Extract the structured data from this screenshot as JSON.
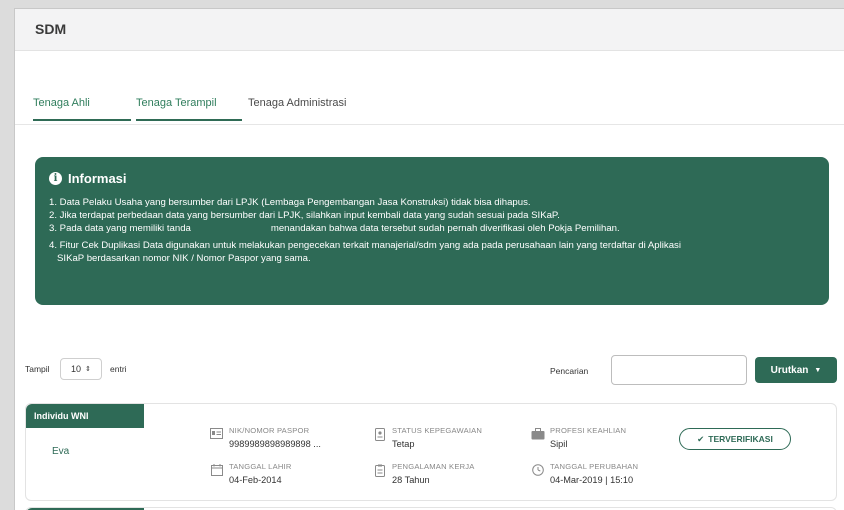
{
  "header": {
    "title": "SDM"
  },
  "tabs": [
    {
      "label": "Tenaga Ahli"
    },
    {
      "label": "Tenaga Terampil"
    },
    {
      "label": "Tenaga Administrasi"
    }
  ],
  "info": {
    "title": "Informasi",
    "items": [
      "1. Data Pelaku Usaha yang bersumber dari LPJK (Lembaga Pengembangan Jasa Konstruksi) tidak bisa dihapus.",
      "2. Jika terdapat perbedaan data yang bersumber dari LPJK, silahkan input kembali data yang sudah sesuai pada SIKaP.",
      "3. Pada data yang memiliki tanda",
      "menandakan bahwa data tersebut sudah pernah diverifikasi oleh Pokja Pemilihan.",
      "4. Fitur Cek Duplikasi Data digunakan untuk melakukan pengecekan terkait manajerial/sdm yang ada pada perusahaan lain yang terdaftar di Aplikasi",
      "SIKaP berdasarkan nomor NIK / Nomor Paspor yang sama."
    ]
  },
  "toolbar": {
    "show_label": "Tampil",
    "entries_value": "10",
    "entries_label": "entri",
    "search_label": "Pencarian",
    "search_value": "",
    "sort_label": "Urutkan"
  },
  "records": [
    {
      "type": "Individu WNI",
      "name": "Eva",
      "nik_label": "NIK/NOMOR PASPOR",
      "nik_value": "9989989898989898 ...",
      "status_label": "STATUS KEPEGAWAIAN",
      "status_value": "Tetap",
      "profesi_label": "PROFESI KEAHLIAN",
      "profesi_value": "Sipil",
      "lahir_label": "TANGGAL LAHIR",
      "lahir_value": "04-Feb-2014",
      "pengalaman_label": "PENGALAMAN KERJA",
      "pengalaman_value": "28 Tahun",
      "perubahan_label": "TANGGAL PERUBAHAN",
      "perubahan_value": "04-Mar-2019 | 15:10",
      "verified_label": "TERVERIFIKASI"
    }
  ],
  "icons": {
    "info": "info-circle-icon",
    "id_card": "id-card-icon",
    "status": "badge-icon",
    "profession": "briefcase-icon",
    "calendar": "calendar-icon",
    "experience": "clipboard-icon",
    "clock": "clock-icon",
    "check": "check-icon",
    "caret": "caret-down-icon",
    "spinner": "sort-arrows-icon"
  },
  "colors": {
    "primary": "#2e6a56",
    "accent_text": "#2f7d5c"
  }
}
